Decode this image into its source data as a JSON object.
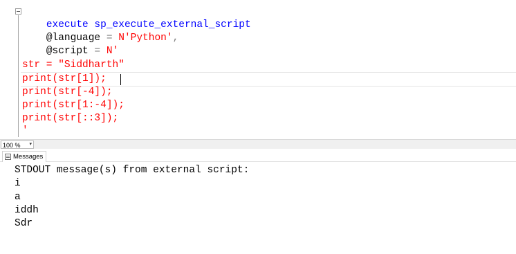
{
  "editor": {
    "line1_keyword": "execute",
    "line1_procedure": " sp_execute_external_script",
    "line2_param": "@language",
    "line2_equals": " = ",
    "line2_value": "N'Python'",
    "line2_comma": ",",
    "line3_param": "@script",
    "line3_equals": " = ",
    "line3_value": "N'",
    "line5": "str = \"Siddharth\"",
    "line6": "print(str[1]);",
    "line7": "print(str[-4]);",
    "line8": "print(str[1:-4]);",
    "line9": "print(str[::3]);",
    "line10": "'"
  },
  "statusbar": {
    "zoom": "100 %"
  },
  "results": {
    "tab_label": "Messages",
    "lines": [
      "STDOUT message(s) from external script:",
      "i",
      "a",
      "iddh",
      "Sdr"
    ]
  },
  "colors": {
    "keyword": "#0000ff",
    "string": "#ff0000",
    "operator": "#808080",
    "text": "#000000"
  }
}
